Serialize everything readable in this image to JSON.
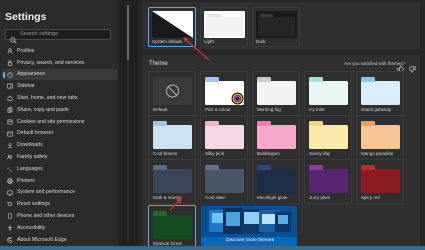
{
  "sidebar": {
    "title": "Settings",
    "search_placeholder": "Search settings",
    "items": [
      {
        "label": "Profiles",
        "icon": "profile-icon"
      },
      {
        "label": "Privacy, search, and services",
        "icon": "lock-icon"
      },
      {
        "label": "Appearance",
        "icon": "appearance-icon",
        "active": true
      },
      {
        "label": "Sidebar",
        "icon": "sidebar-icon"
      },
      {
        "label": "Start, home, and new tabs",
        "icon": "home-icon"
      },
      {
        "label": "Share, copy and paste",
        "icon": "share-icon"
      },
      {
        "label": "Cookies and site permissions",
        "icon": "cookie-icon"
      },
      {
        "label": "Default browser",
        "icon": "browser-icon"
      },
      {
        "label": "Downloads",
        "icon": "download-icon"
      },
      {
        "label": "Family safety",
        "icon": "family-icon"
      },
      {
        "label": "Languages",
        "icon": "language-icon"
      },
      {
        "label": "Printers",
        "icon": "printer-icon"
      },
      {
        "label": "System and performance",
        "icon": "system-icon"
      },
      {
        "label": "Reset settings",
        "icon": "reset-icon"
      },
      {
        "label": "Phone and other devices",
        "icon": "phone-icon"
      },
      {
        "label": "Accessibility",
        "icon": "accessibility-icon"
      },
      {
        "label": "About Microsoft Edge",
        "icon": "edge-icon"
      }
    ]
  },
  "modes": [
    {
      "label": "System default",
      "selected": true
    },
    {
      "label": "Light"
    },
    {
      "label": "Dark"
    }
  ],
  "theme": {
    "section_label": "Theme",
    "feedback_text": "Are you satisfied with themes?",
    "cards": [
      {
        "label": "Default",
        "tab": "#3a3a3a",
        "body": "#3a3a3a"
      },
      {
        "label": "Pick a colour",
        "tab": "#9fc4f0",
        "body": "#ffffff"
      },
      {
        "label": "Morning fog",
        "tab": "#c9cdd3",
        "body": "#f3f3f3"
      },
      {
        "label": "Icy mint",
        "tab": "#a7e1d7",
        "body": "#e9f7f4"
      },
      {
        "label": "Island getaway",
        "tab": "#86c6ef",
        "body": "#d9eefb"
      },
      {
        "label": "Cool breeze",
        "tab": "#9fc6e8",
        "body": "#cfe2f3"
      },
      {
        "label": "Silky pink",
        "tab": "#f3b3cc",
        "body": "#f7d7e5"
      },
      {
        "label": "Bubblegum",
        "tab": "#ec7fb6",
        "body": "#f6a9cd"
      },
      {
        "label": "Sunny day",
        "tab": "#f6d96c",
        "body": "#faebac"
      },
      {
        "label": "Mango paradise",
        "tab": "#f1a05c",
        "body": "#f7c59a"
      },
      {
        "label": "Dark & stormy",
        "tab": "#5a6e86",
        "body": "#3a475a"
      },
      {
        "label": "Cool slate",
        "tab": "#637287",
        "body": "#4a5566"
      },
      {
        "label": "Moonlight glow",
        "tab": "#2b4a7c",
        "body": "#1f2e48"
      },
      {
        "label": "Juicy plum",
        "tab": "#8a3fa0",
        "body": "#5a2470"
      },
      {
        "label": "Spicy red",
        "tab": "#c4292f",
        "body": "#8a1c22"
      },
      {
        "label": "Mystical forest",
        "tab": "#236b2f",
        "body": "#164d20",
        "selected": true
      }
    ],
    "discover_label": "Discover more themes"
  },
  "colors": {
    "accent": "#5aa8e6",
    "annotation": "#d32f2f",
    "discover_bg": "#0067c0"
  }
}
